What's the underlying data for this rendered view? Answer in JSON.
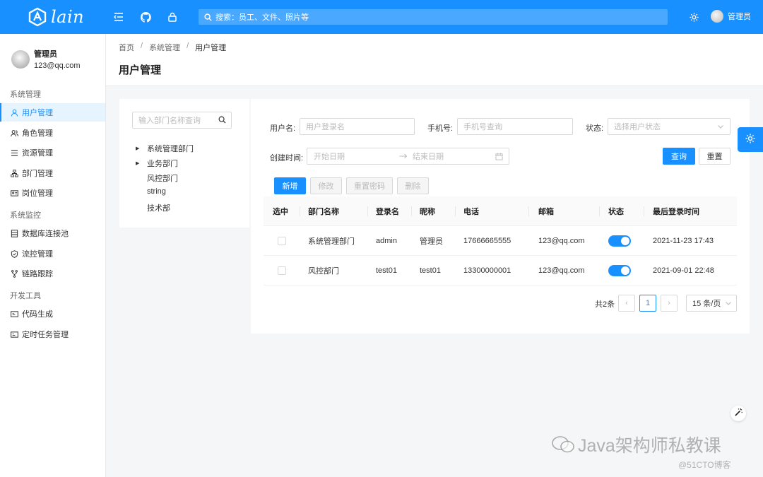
{
  "header": {
    "logo_text": "lain",
    "search_placeholder": "搜索：员工、文件、照片等",
    "user_name": "管理员"
  },
  "sidebar": {
    "user": {
      "name": "管理员",
      "email": "123@qq.com"
    },
    "groups": [
      {
        "title": "系统管理",
        "items": [
          {
            "label": "用户管理",
            "icon": "user-icon",
            "active": true
          },
          {
            "label": "角色管理",
            "icon": "team-icon"
          },
          {
            "label": "资源管理",
            "icon": "menu-icon"
          },
          {
            "label": "部门管理",
            "icon": "cluster-icon"
          },
          {
            "label": "岗位管理",
            "icon": "idcard-icon"
          }
        ]
      },
      {
        "title": "系统监控",
        "items": [
          {
            "label": "数据库连接池",
            "icon": "database-icon"
          },
          {
            "label": "流控管理",
            "icon": "shield-icon"
          },
          {
            "label": "链路跟踪",
            "icon": "fork-icon"
          }
        ]
      },
      {
        "title": "开发工具",
        "items": [
          {
            "label": "代码生成",
            "icon": "code-icon"
          },
          {
            "label": "定时任务管理",
            "icon": "schedule-icon"
          }
        ]
      }
    ]
  },
  "breadcrumb": [
    "首页",
    "系统管理",
    "用户管理"
  ],
  "page_title": "用户管理",
  "dept_tree": {
    "search_placeholder": "输入部门名称查询",
    "nodes": [
      {
        "label": "系统管理部门",
        "expandable": true
      },
      {
        "label": "业务部门",
        "expandable": true
      },
      {
        "label": "风控部门",
        "expandable": false
      },
      {
        "label": "string",
        "expandable": false
      },
      {
        "label": "技术部",
        "expandable": false
      }
    ]
  },
  "filters": {
    "username_label": "用户名:",
    "username_placeholder": "用户登录名",
    "phone_label": "手机号:",
    "phone_placeholder": "手机号查询",
    "status_label": "状态:",
    "status_placeholder": "选择用户状态",
    "created_label": "创建时间:",
    "start_placeholder": "开始日期",
    "end_placeholder": "结束日期",
    "query_button": "查询",
    "reset_button": "重置"
  },
  "actions": {
    "add": "新增",
    "edit": "修改",
    "reset_password": "重置密码",
    "delete": "删除"
  },
  "table": {
    "columns": [
      "选中",
      "部门名称",
      "登录名",
      "昵称",
      "电话",
      "邮箱",
      "状态",
      "最后登录时间"
    ],
    "rows": [
      {
        "dept": "系统管理部门",
        "login": "admin",
        "nickname": "管理员",
        "phone": "17666665555",
        "email": "123@qq.com",
        "enabled": true,
        "last_login": "2021-11-23 17:43"
      },
      {
        "dept": "风控部门",
        "login": "test01",
        "nickname": "test01",
        "phone": "13300000001",
        "email": "123@qq.com",
        "enabled": true,
        "last_login": "2021-09-01 22:48"
      }
    ]
  },
  "pagination": {
    "total_text": "共2条",
    "current_page": "1",
    "page_size": "15 条/页"
  },
  "watermark": {
    "text": "Java架构师私教课",
    "source": "@51CTO博客"
  },
  "colors": {
    "primary": "#1890ff",
    "sidebar_active_bg": "#e6f4ff"
  }
}
